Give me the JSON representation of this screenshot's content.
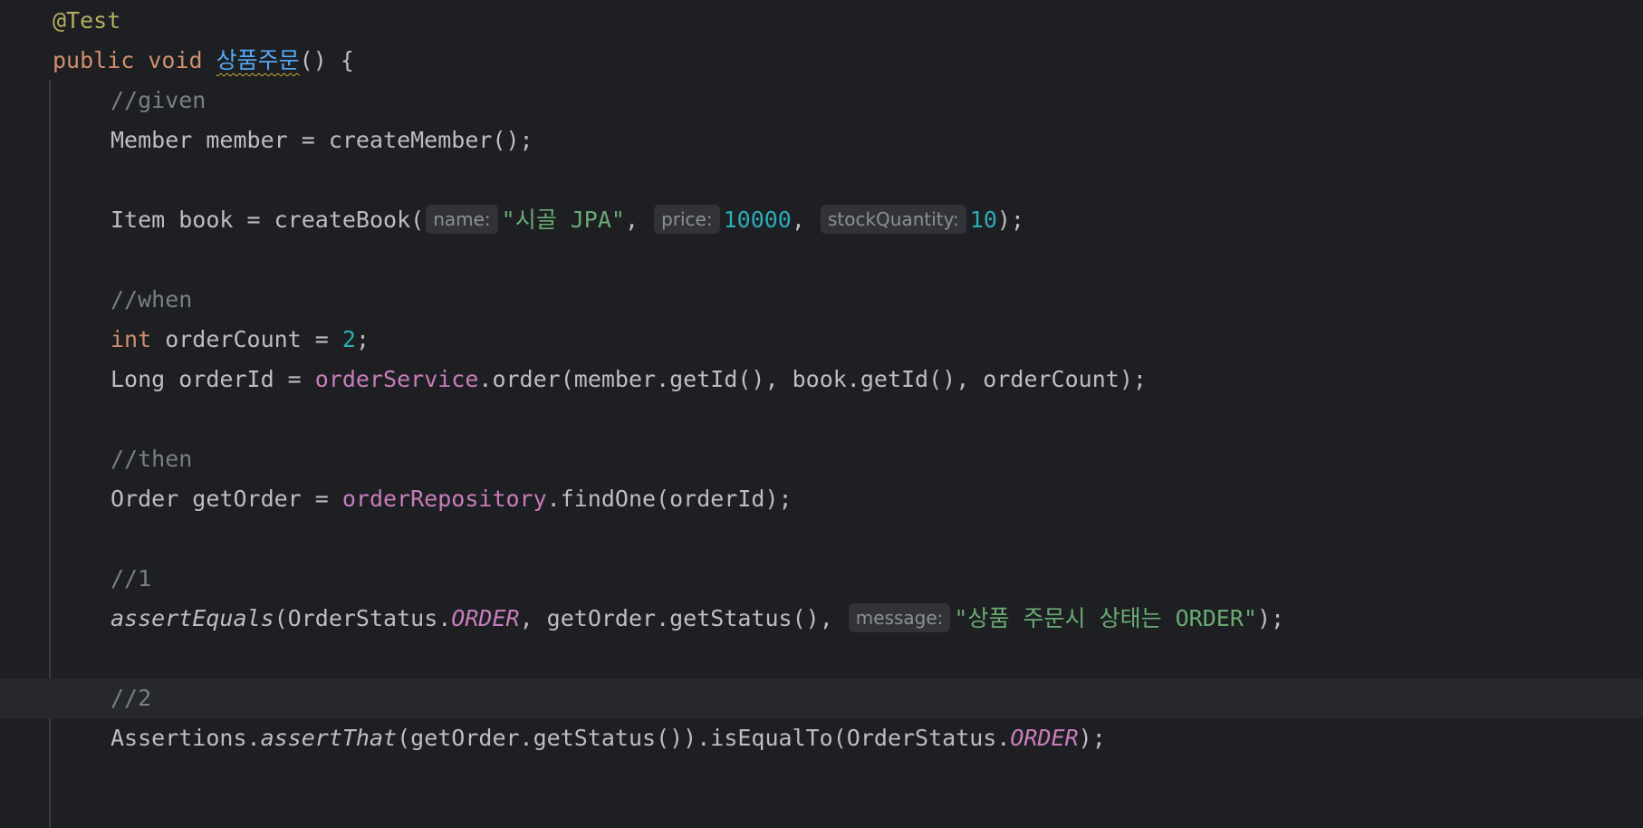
{
  "editor": {
    "annotation": "@Test",
    "kw_public": "public",
    "kw_void": "void",
    "method_name": "상품주문",
    "method_sig_tail": "() {",
    "comment_given": "//given",
    "line_member": "Member member = createMember();",
    "line_item_start": "Item book = createBook(",
    "hint_name": "name:",
    "str_book_name": "\"시골 JPA\"",
    "comma1": ", ",
    "hint_price": "price:",
    "num_price": "10000",
    "comma2": ", ",
    "hint_stock": "stockQuantity:",
    "num_stock": "10",
    "line_item_end": ");",
    "comment_when": "//when",
    "kw_int": "int",
    "order_count_mid": " orderCount = ",
    "num_order_count": "2",
    "semicolon": ";",
    "order_id_start": "Long orderId = ",
    "field_order_service": "orderService",
    "order_id_end": ".order(member.getId(), book.getId(), orderCount);",
    "comment_then": "//then",
    "get_order_start": "Order getOrder = ",
    "field_order_repository": "orderRepository",
    "get_order_end": ".findOne(orderId);",
    "comment_1": "//1",
    "assert_equals": "assertEquals",
    "assert_equals_mid": "(OrderStatus.",
    "const_order_1": "ORDER",
    "assert_equals_mid2": ", getOrder.getStatus(), ",
    "hint_message": "message:",
    "str_message": "\"상품 주문시 상태는 ORDER\"",
    "assert_equals_end": ");",
    "comment_2": "//2",
    "assertions_class": "Assertions.",
    "assert_that": "assertThat",
    "assert_that_mid": "(getOrder.getStatus()).isEqualTo(OrderStatus.",
    "const_order_2": "ORDER",
    "assert_that_end": ");"
  }
}
